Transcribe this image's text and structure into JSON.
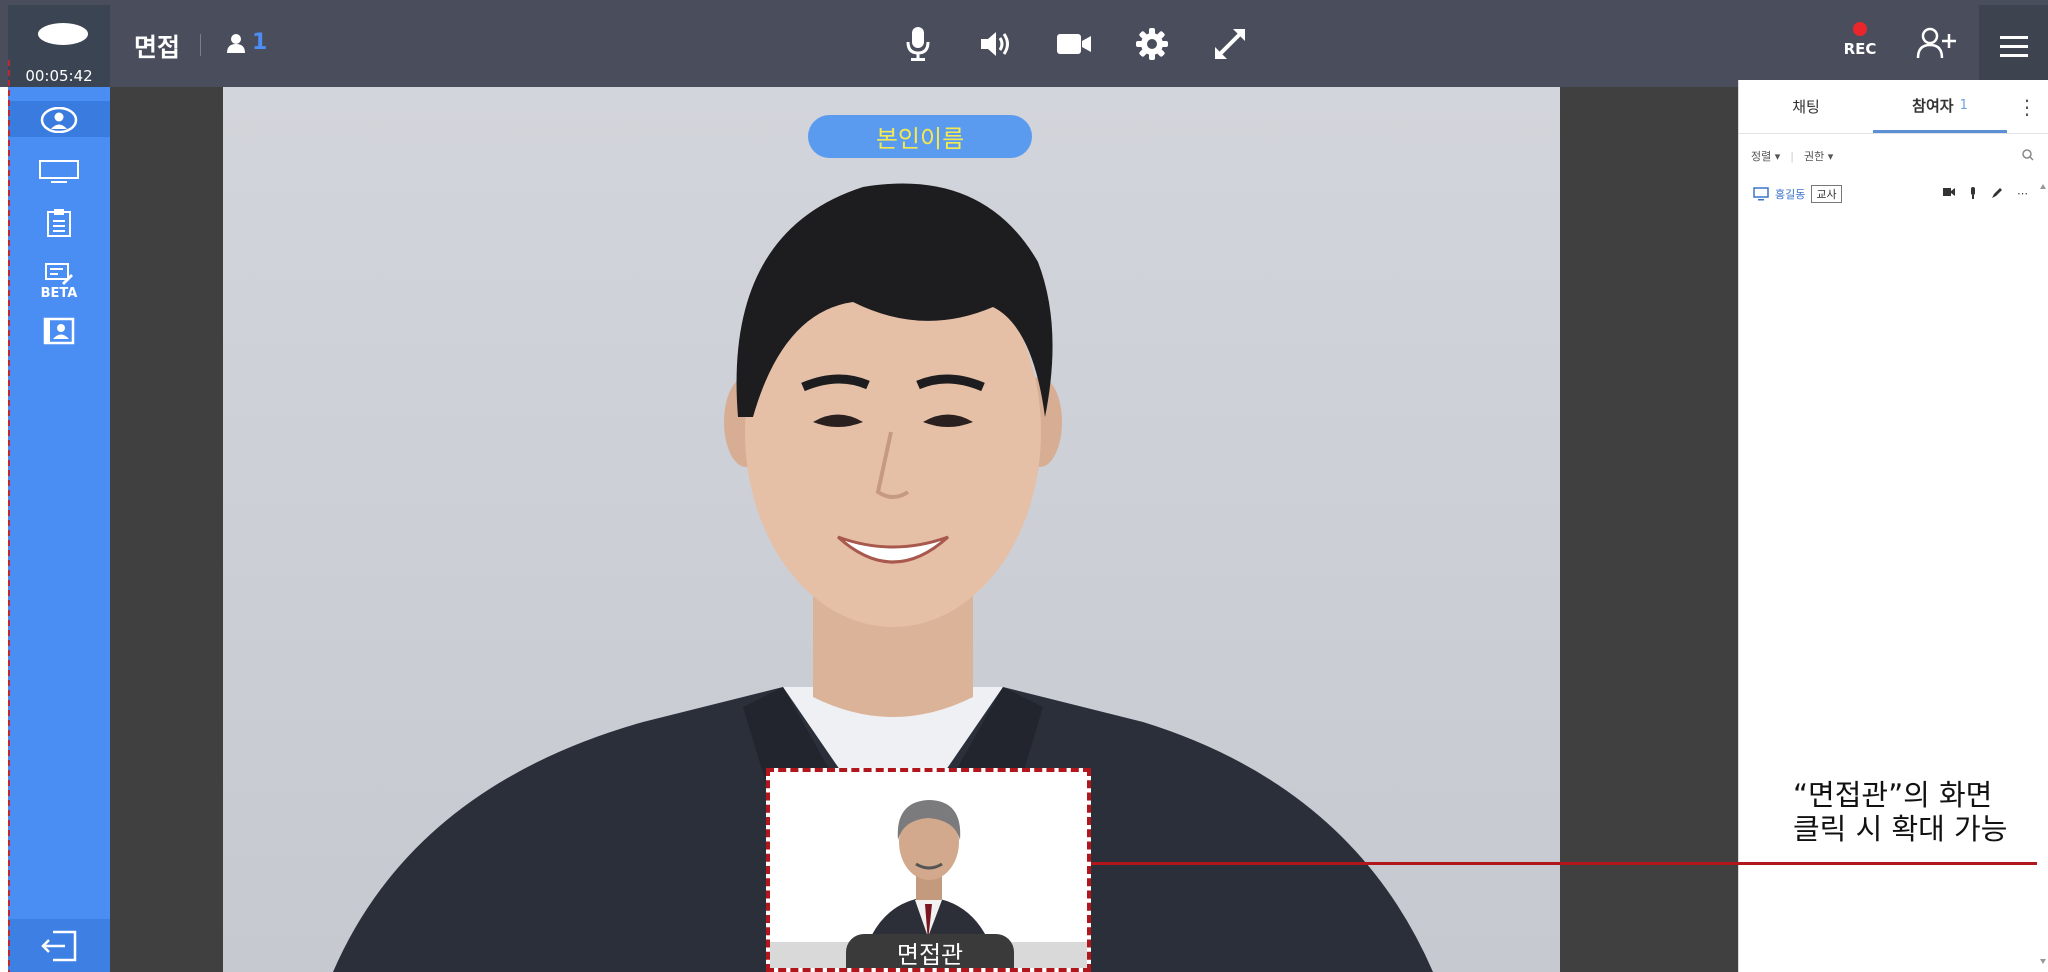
{
  "header": {
    "timer": "00:05:42",
    "title": "면접",
    "participant_count": "1",
    "rec_label": "REC",
    "controls": [
      "microphone-icon",
      "speaker-icon",
      "camera-icon",
      "settings-icon",
      "expand-icon"
    ]
  },
  "sidebar": {
    "beta_label": "BETA"
  },
  "video": {
    "self_name": "본인이름",
    "pip_label": "면접관"
  },
  "panel": {
    "tab_chat": "채팅",
    "tab_participants": "참여자",
    "participants_count": "1",
    "filter_sort": "정렬 ▾",
    "filter_permission": "권한 ▾",
    "participant_name": "홍길동",
    "participant_role": "교사"
  },
  "annotation": {
    "text": "“면접관”의 화면\n클릭 시 확대 가능"
  },
  "colors": {
    "topbar": "#4a4e5c",
    "sidebar": "#4b8ef3",
    "accent_red": "#b0161c",
    "name_text": "#f4e94e"
  }
}
